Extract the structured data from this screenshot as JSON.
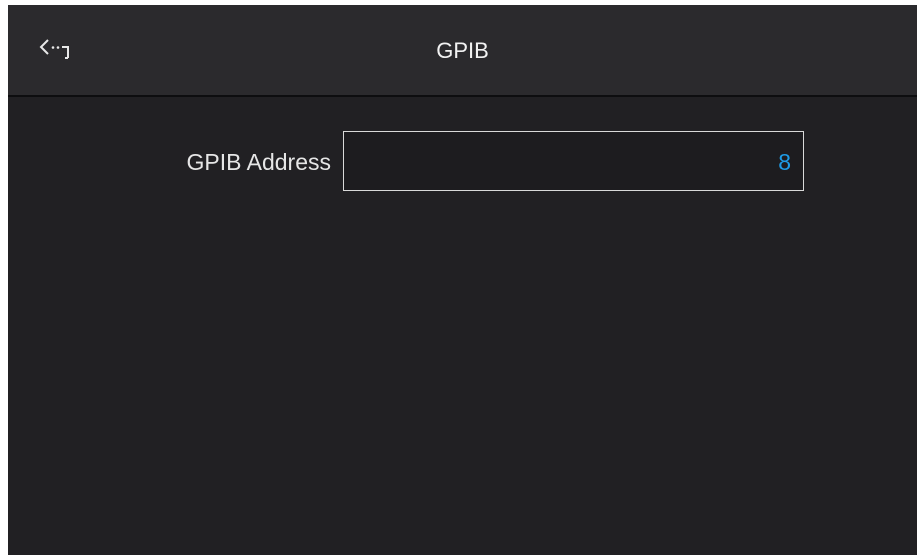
{
  "header": {
    "title": "GPIB",
    "back_icon": "back-arrow-icon"
  },
  "form": {
    "address_label": "GPIB Address",
    "address_value": "8"
  },
  "colors": {
    "background": "#212023",
    "header_background": "#2b2a2d",
    "value_accent": "#1e9be6",
    "text": "#f2f2f2"
  }
}
